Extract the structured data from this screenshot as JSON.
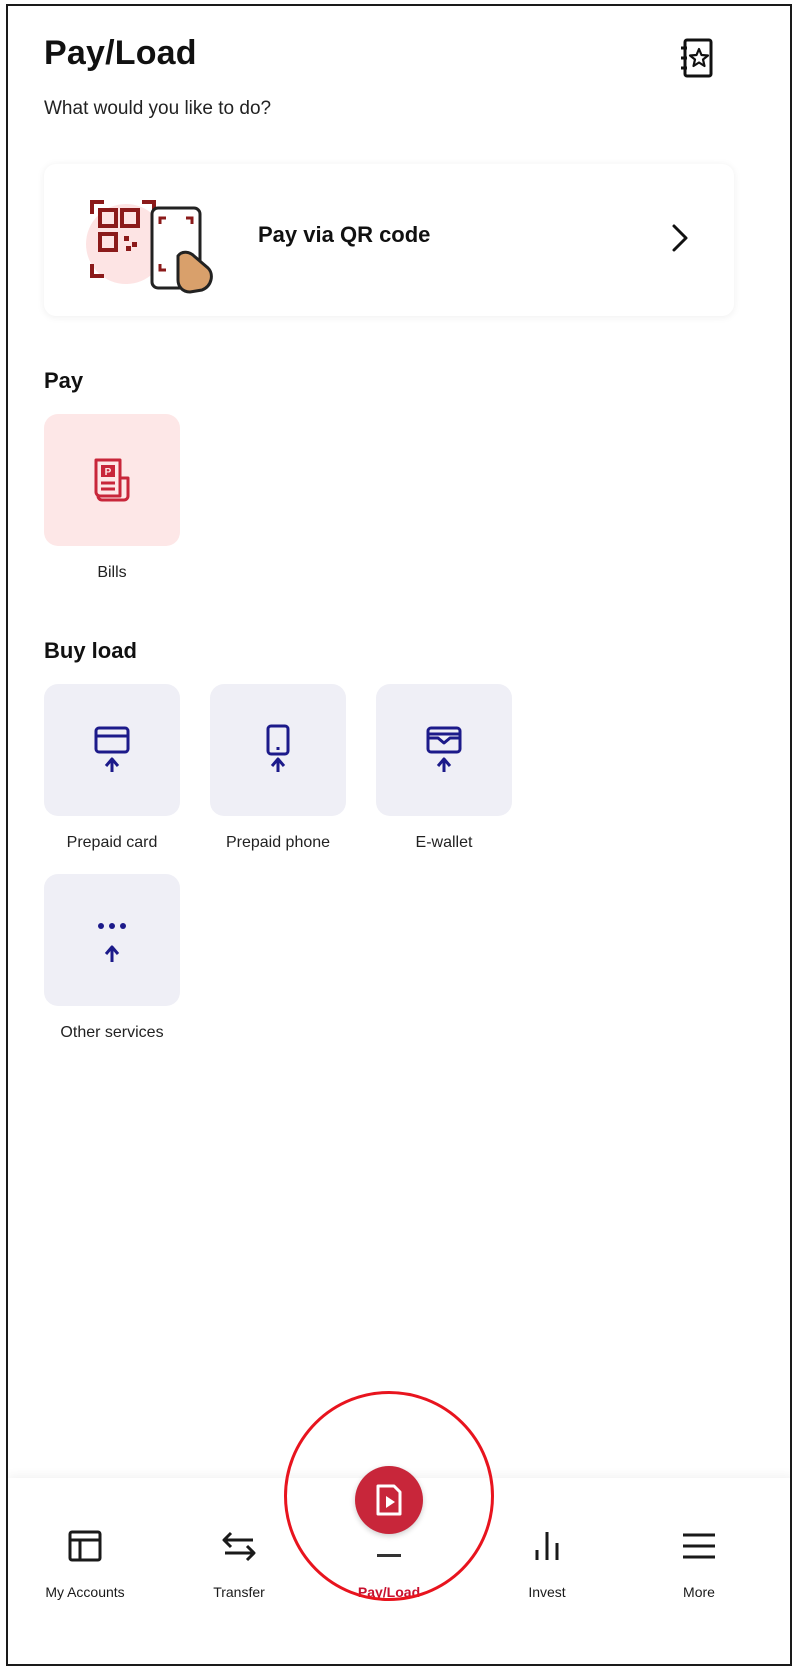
{
  "header": {
    "title": "Pay/Load",
    "subtitle": "What would you like to do?",
    "favorites_icon": "contact-book-star-icon"
  },
  "qr_card": {
    "label": "Pay via QR code",
    "illustration": "qr-scan-phone-hand-icon"
  },
  "pay_section": {
    "title": "Pay",
    "items": [
      {
        "label": "Bills",
        "icon": "bill-receipt-icon"
      }
    ]
  },
  "load_section": {
    "title": "Buy load",
    "items": [
      {
        "label": "Prepaid card",
        "icon": "card-upload-icon"
      },
      {
        "label": "Prepaid phone",
        "icon": "phone-upload-icon"
      },
      {
        "label": "E-wallet",
        "icon": "wallet-upload-icon"
      },
      {
        "label": "Other services",
        "icon": "more-upload-icon"
      }
    ]
  },
  "bottom_nav": {
    "active": "Pay/Load",
    "items": [
      {
        "label": "My Accounts",
        "icon": "accounts-icon"
      },
      {
        "label": "Transfer",
        "icon": "transfer-arrows-icon"
      },
      {
        "label": "Pay/Load",
        "icon": "pay-load-icon"
      },
      {
        "label": "Invest",
        "icon": "bar-chart-icon"
      },
      {
        "label": "More",
        "icon": "menu-icon"
      }
    ]
  },
  "colors": {
    "brand_red": "#c8263a",
    "pay_tile_bg": "#fde7e7",
    "load_tile_bg": "#efeff6",
    "load_icon": "#1c1a8a",
    "annotation_ring": "#e8141e"
  }
}
